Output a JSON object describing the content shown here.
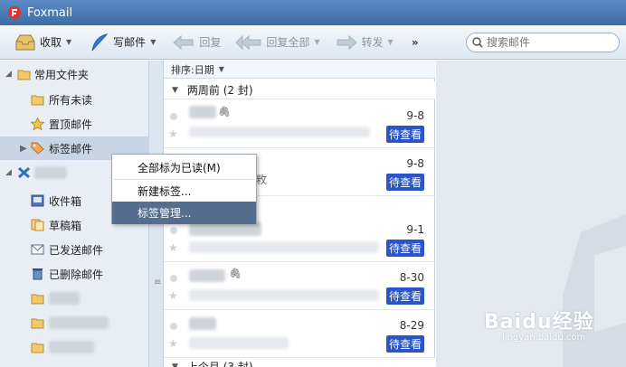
{
  "app": {
    "title": "Foxmail"
  },
  "toolbar": {
    "receive": "收取",
    "compose": "写邮件",
    "reply": "回复",
    "reply_all": "回复全部",
    "forward": "转发",
    "more": "»",
    "search_placeholder": "搜索邮件"
  },
  "sidebar": {
    "common_folder": "常用文件夹",
    "all_unread": "所有未读",
    "pinned": "置顶邮件",
    "tagged": "标签邮件",
    "inbox": "收件箱",
    "drafts": "草稿箱",
    "sent": "已发送邮件",
    "deleted": "已删除邮件"
  },
  "maillist": {
    "sort_label": "排序:日期",
    "groups": [
      "两周前 (2 封)",
      "上个月 (3 封)"
    ],
    "mails": [
      {
        "date": "9-8",
        "tag": "待查看"
      },
      {
        "date": "9-8",
        "tag": "待查看",
        "snippet": "敉"
      },
      {
        "date": "9-1",
        "tag": "待查看"
      },
      {
        "date": "8-30",
        "tag": "待查看"
      },
      {
        "date": "8-29",
        "tag": "待查看"
      }
    ]
  },
  "context_menu": {
    "mark_all_read": "全部标为已读(M)",
    "new_tag": "新建标签...",
    "manage_tags": "标签管理..."
  },
  "watermark": {
    "brand": "Baidu经验",
    "url": "jingyan.baidu.com"
  },
  "colors": {
    "title_bar": "#4a78b3",
    "tag_bg": "#2b54c9",
    "menu_hover": "#556e8e"
  }
}
